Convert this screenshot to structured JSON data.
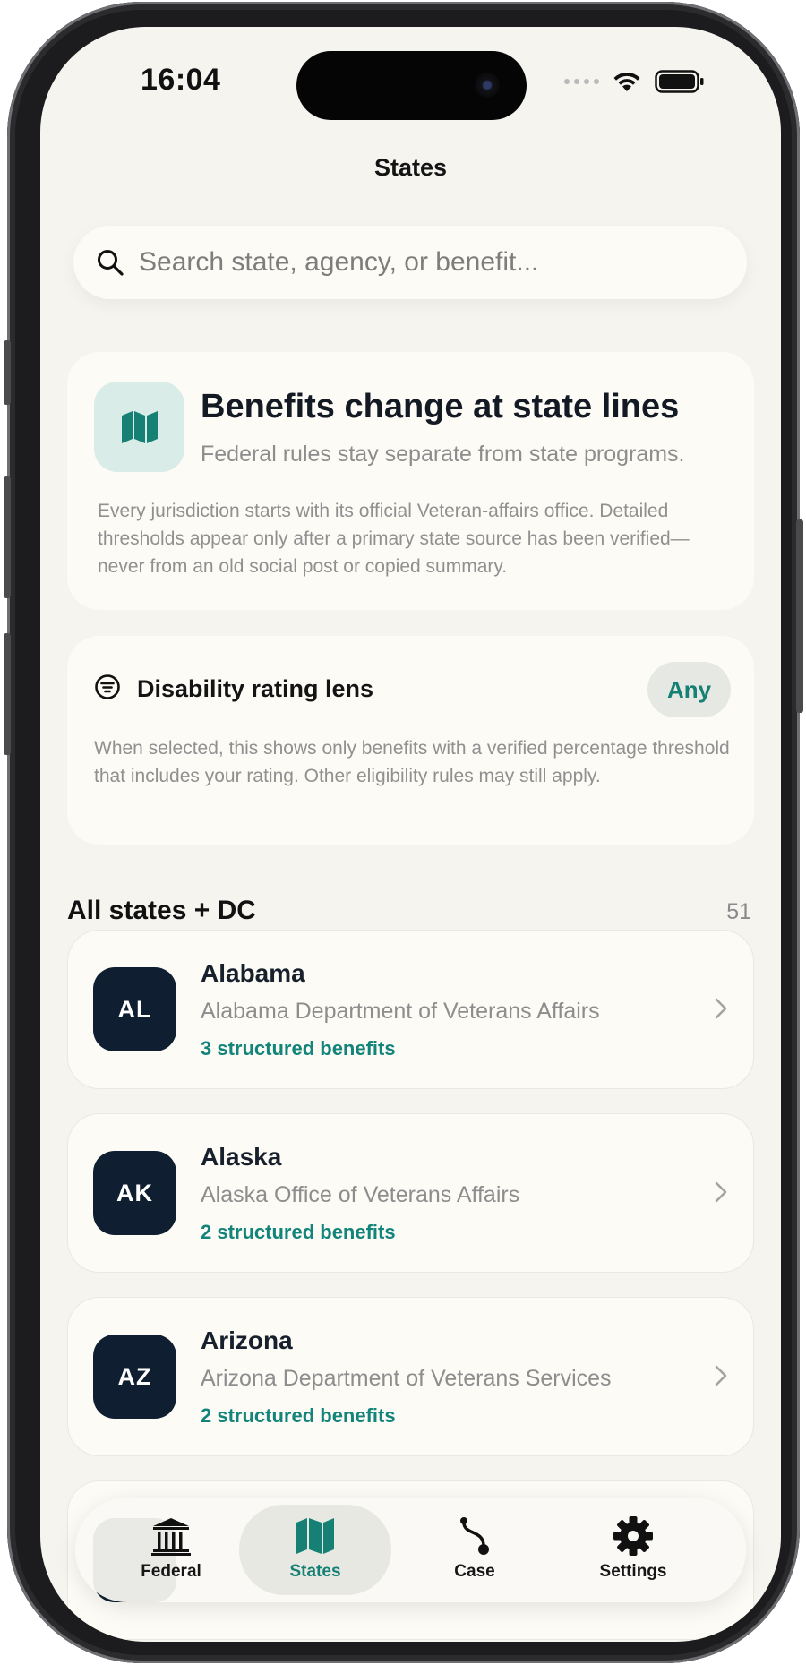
{
  "status_bar": {
    "time": "16:04"
  },
  "nav": {
    "title": "States"
  },
  "search": {
    "placeholder": "Search state, agency, or benefit..."
  },
  "hero": {
    "icon": "map-icon",
    "title": "Benefits change at state lines",
    "subtitle": "Federal rules stay separate from state programs.",
    "body": "Every jurisdiction starts with its official Veteran-affairs office. Detailed thresholds appear only after a primary state source has been verified—never from an old social post or copied summary."
  },
  "lens": {
    "icon": "filter-icon",
    "title": "Disability rating lens",
    "selected": "Any",
    "body": "When selected, this shows only benefits with a verified percentage threshold that includes your rating. Other eligibility rules may still apply."
  },
  "states_section": {
    "title": "All states + DC",
    "count": "51"
  },
  "states": [
    {
      "code": "AL",
      "name": "Alabama",
      "agency": "Alabama Department of Veterans Affairs",
      "benefits": "3 structured benefits"
    },
    {
      "code": "AK",
      "name": "Alaska",
      "agency": "Alaska Office of Veterans Affairs",
      "benefits": "2 structured benefits"
    },
    {
      "code": "AZ",
      "name": "Arizona",
      "agency": "Arizona Department of Veterans Services",
      "benefits": "2 structured benefits"
    }
  ],
  "tabbar": {
    "tabs": [
      {
        "label": "Federal",
        "icon": "bank-icon"
      },
      {
        "label": "States",
        "icon": "map-icon",
        "active": true
      },
      {
        "label": "Case",
        "icon": "route-icon"
      },
      {
        "label": "Settings",
        "icon": "gear-icon"
      }
    ]
  },
  "colors": {
    "accent": "#168074",
    "badge_bg": "#0f1f31",
    "background": "#f5f4ef",
    "card": "#fcfbf6"
  }
}
